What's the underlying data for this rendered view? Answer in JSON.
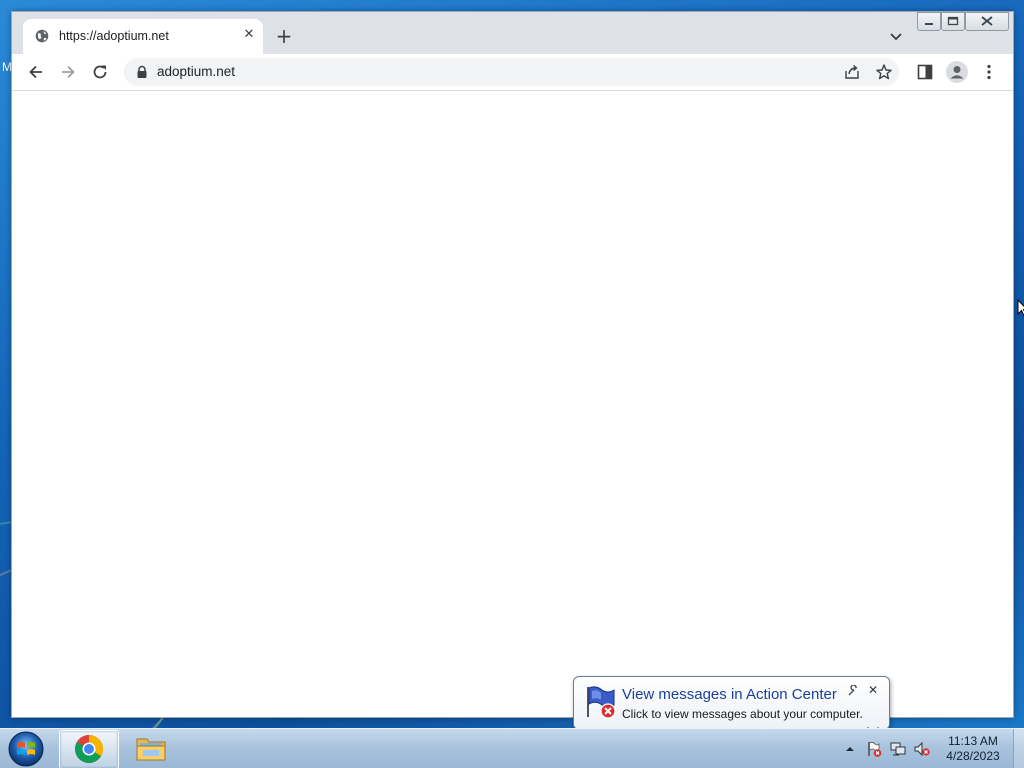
{
  "browser": {
    "tab": {
      "title": "https://adoptium.net"
    },
    "omnibox": {
      "url": "adoptium.net"
    }
  },
  "desktop": {
    "edge_label": "M"
  },
  "notification": {
    "title": "View messages in Action Center",
    "text": "Click to view messages about your computer."
  },
  "taskbar": {
    "clock": {
      "time": "11:13 AM",
      "date": "4/28/2023"
    }
  },
  "colors": {
    "accent": "#1a73e8",
    "chrome_frame": "#dee1e6",
    "balloon_title": "#1b3f9a"
  }
}
